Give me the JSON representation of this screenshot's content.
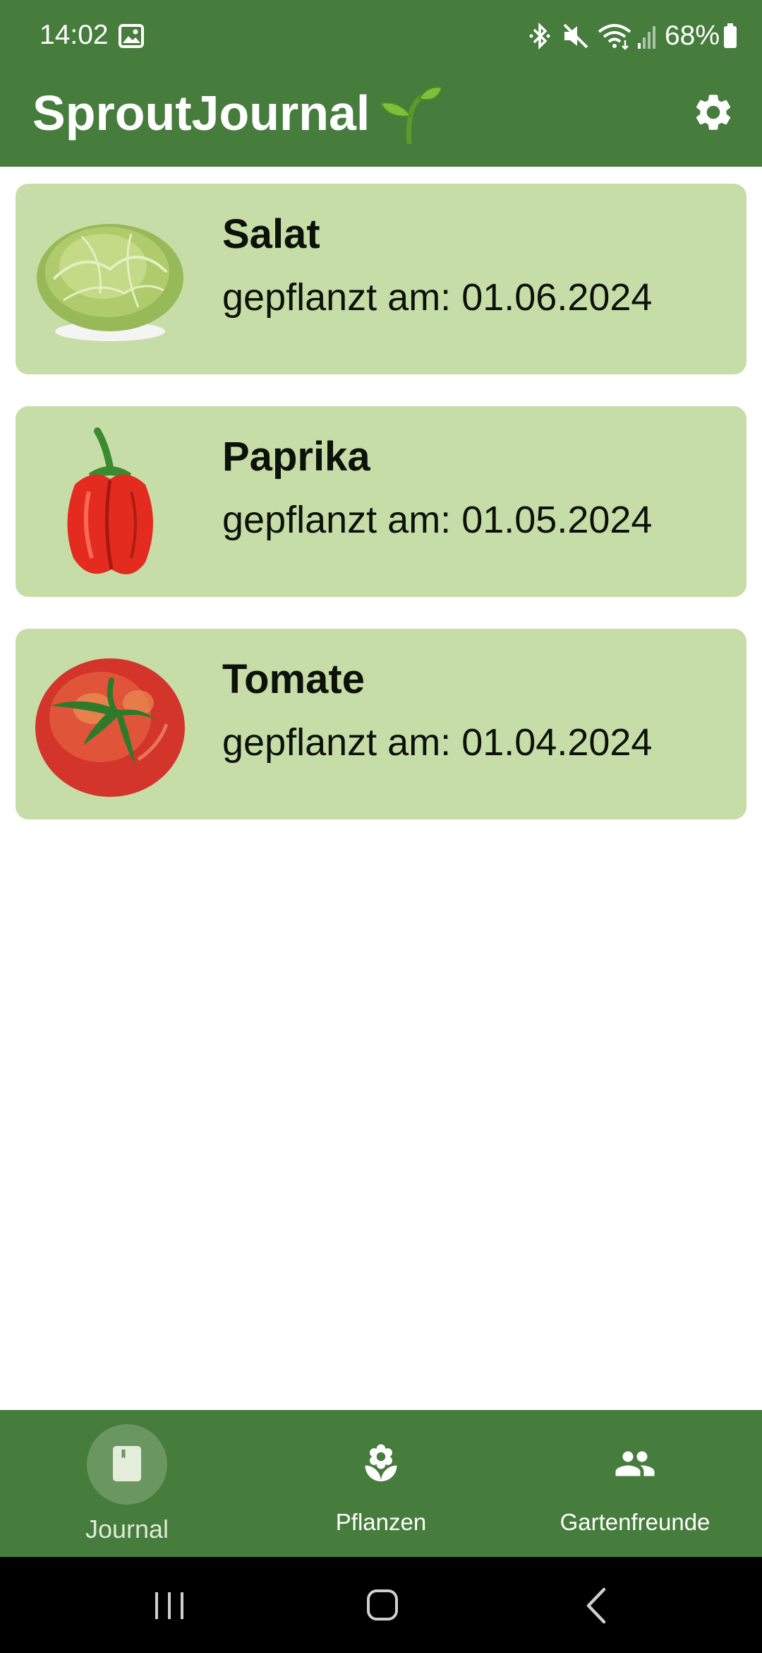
{
  "status_bar": {
    "time": "14:02",
    "battery": "68%",
    "icons": [
      "gallery-icon",
      "bluetooth-icon",
      "mute-icon",
      "wifi-icon",
      "signal-icon",
      "battery-icon"
    ]
  },
  "app_bar": {
    "title": "SproutJournal",
    "title_icon": "sprout-icon",
    "settings_icon": "gear-icon"
  },
  "plants": [
    {
      "name": "Salat",
      "date": "gepflanzt am: 01.06.2024",
      "image": "lettuce-image"
    },
    {
      "name": "Paprika",
      "date": "gepflanzt am: 01.05.2024",
      "image": "bell-pepper-image"
    },
    {
      "name": "Tomate",
      "date": "gepflanzt am: 01.04.2024",
      "image": "tomato-image"
    }
  ],
  "bottom_nav": {
    "items": [
      {
        "label": "Journal",
        "icon": "book-icon",
        "active": true
      },
      {
        "label": "Pflanzen",
        "icon": "flower-icon",
        "active": false
      },
      {
        "label": "Gartenfreunde",
        "icon": "people-icon",
        "active": false
      }
    ]
  },
  "system_nav": [
    "recents-button",
    "home-button",
    "back-button"
  ],
  "colors": {
    "primary": "#467c3c",
    "card_background": "#c6dda8",
    "active_pill": "#6a9760",
    "text_dark": "#0c120a"
  }
}
